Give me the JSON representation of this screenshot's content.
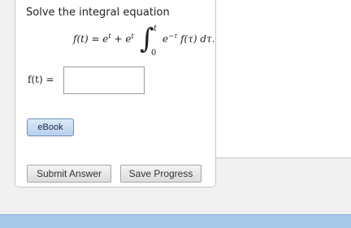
{
  "question": {
    "prompt": "Solve the integral equation",
    "equation": {
      "lhs_text": "f(t) = e",
      "lhs_sup1": "t",
      "lhs_plus": " + e",
      "lhs_sup2": "t",
      "integral_symbol": "∫",
      "upper_limit": "t",
      "lower_limit": "0",
      "integrand_base": "e",
      "integrand_sup": "−τ",
      "integrand_rest": "f(τ) dτ."
    },
    "answer_label": "f(t) =",
    "answer_value": ""
  },
  "buttons": {
    "ebook": "eBook",
    "submit": "Submit Answer",
    "save": "Save Progress"
  },
  "colors": {
    "ebook_accent": "#b7cfec",
    "bottom_bar": "#a7c7e6"
  }
}
